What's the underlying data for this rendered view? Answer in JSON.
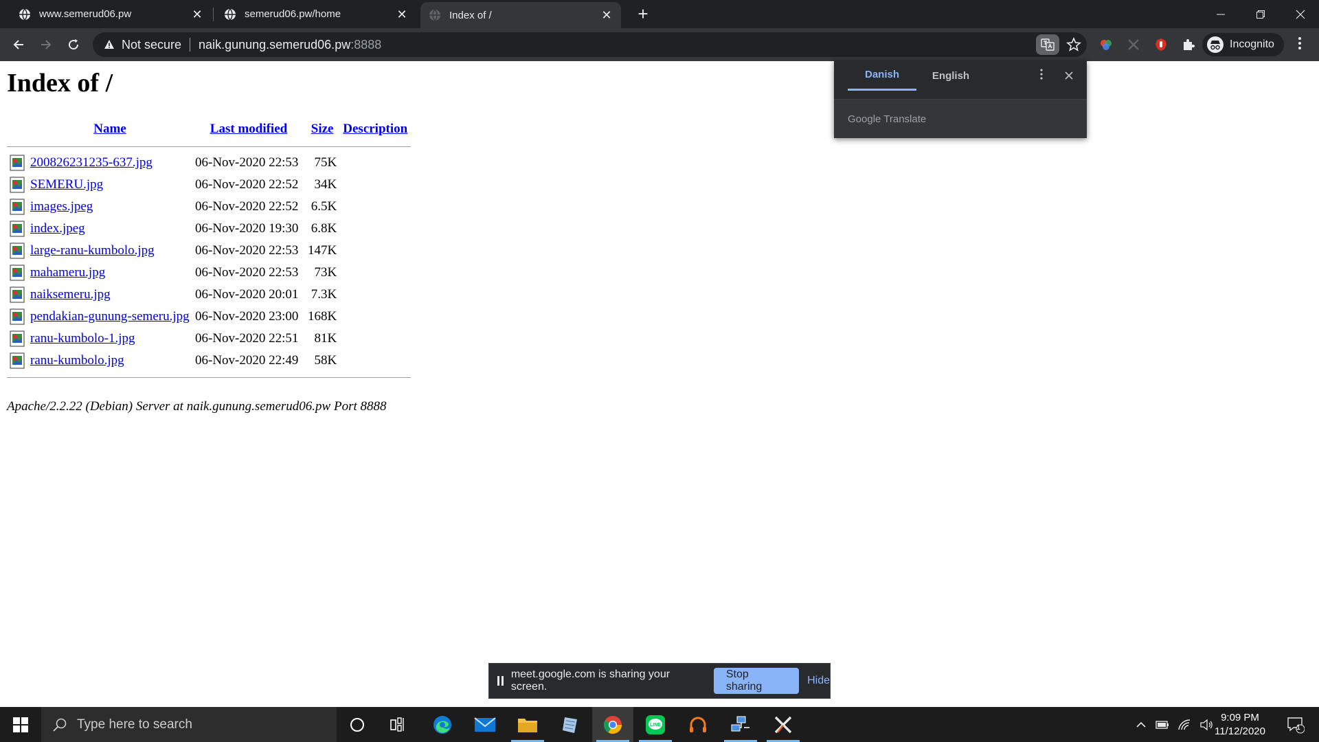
{
  "browser": {
    "tabs": [
      {
        "title": "www.semerud06.pw"
      },
      {
        "title": "semerud06.pw/home"
      },
      {
        "title": "Index of /"
      }
    ],
    "omnibox": {
      "security_label": "Not secure",
      "host": "naik.gunung.semerud06.pw",
      "port": ":8888"
    },
    "profile_label": "Incognito"
  },
  "page": {
    "heading": "Index of /",
    "columns": {
      "name": "Name",
      "last_modified": "Last modified",
      "size": "Size",
      "description": "Description"
    },
    "files": [
      {
        "name": "200826231235-637.jpg",
        "modified": "06-Nov-2020 22:53",
        "size": "75K"
      },
      {
        "name": "SEMERU.jpg",
        "modified": "06-Nov-2020 22:52",
        "size": "34K"
      },
      {
        "name": "images.jpeg",
        "modified": "06-Nov-2020 22:52",
        "size": "6.5K"
      },
      {
        "name": "index.jpeg",
        "modified": "06-Nov-2020 19:30",
        "size": "6.8K"
      },
      {
        "name": "large-ranu-kumbolo.jpg",
        "modified": "06-Nov-2020 22:53",
        "size": "147K"
      },
      {
        "name": "mahameru.jpg",
        "modified": "06-Nov-2020 22:53",
        "size": "73K"
      },
      {
        "name": "naiksemeru.jpg",
        "modified": "06-Nov-2020 20:01",
        "size": "7.3K"
      },
      {
        "name": "pendakian-gunung-semeru.jpg",
        "modified": "06-Nov-2020 23:00",
        "size": "168K"
      },
      {
        "name": "ranu-kumbolo-1.jpg",
        "modified": "06-Nov-2020 22:51",
        "size": "81K"
      },
      {
        "name": "ranu-kumbolo.jpg",
        "modified": "06-Nov-2020 22:49",
        "size": "58K"
      }
    ],
    "server_signature": "Apache/2.2.22 (Debian) Server at naik.gunung.semerud06.pw Port 8888"
  },
  "translate_popup": {
    "source_language": "Danish",
    "target_language": "English",
    "footer": "Google Translate"
  },
  "share_bar": {
    "message": "meet.google.com is sharing your screen.",
    "stop_label": "Stop sharing",
    "hide_label": "Hide"
  },
  "taskbar": {
    "search_placeholder": "Type here to search",
    "time": "9:09 PM",
    "date": "11/12/2020",
    "notification_count": "1"
  },
  "colors": {
    "link": "#0000ee",
    "chrome_dark": "#202124",
    "chrome_toolbar": "#35363a",
    "accent_blue": "#8ab4f8",
    "taskbar": "#1c1c1c"
  }
}
